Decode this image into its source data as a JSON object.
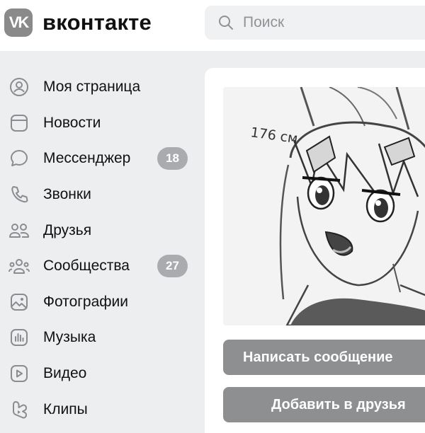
{
  "header": {
    "logo_mark": "VK",
    "logo_text": "вконтакте",
    "search_placeholder": "Поиск"
  },
  "sidebar": {
    "items": [
      {
        "label": "Моя страница",
        "icon": "user-circle-icon"
      },
      {
        "label": "Новости",
        "icon": "news-icon"
      },
      {
        "label": "Мессенджер",
        "icon": "message-bubble-icon",
        "badge": "18"
      },
      {
        "label": "Звонки",
        "icon": "phone-icon"
      },
      {
        "label": "Друзья",
        "icon": "friends-icon"
      },
      {
        "label": "Сообщества",
        "icon": "communities-icon",
        "badge": "27"
      },
      {
        "label": "Фотографии",
        "icon": "photo-icon"
      },
      {
        "label": "Музыка",
        "icon": "music-icon"
      },
      {
        "label": "Видео",
        "icon": "video-icon"
      },
      {
        "label": "Клипы",
        "icon": "clips-icon"
      }
    ]
  },
  "profile": {
    "drawing_annotation": "176 см",
    "write_message_label": "Написать сообщение",
    "add_friend_label": "Добавить в друзья"
  },
  "colors": {
    "page_bg": "#edeef0",
    "card_bg": "#ffffff",
    "button_bg": "#8e8f91",
    "badge_bg": "#a9abae",
    "icon": "#8a8c90"
  }
}
